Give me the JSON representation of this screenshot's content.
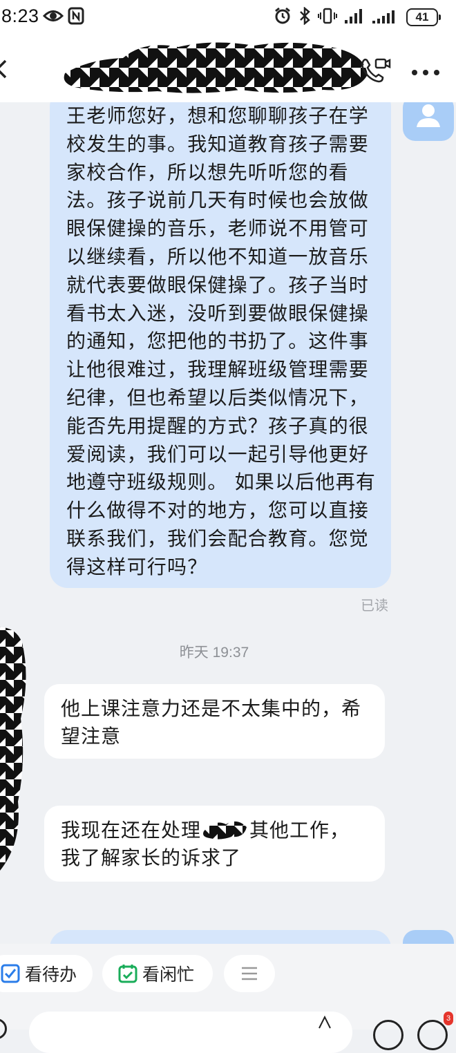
{
  "status_bar": {
    "time": "8:23",
    "battery": "41"
  },
  "header": {
    "contact_name": ""
  },
  "messages": {
    "outgoing": {
      "text": "王老师您好，想和您聊聊孩子在学校发生的事。我知道教育孩子需要家校合作，所以想先听听您的看法。孩子说前几天有时候也会放做眼保健操的音乐，老师说不用管可以继续看，所以他不知道一放音乐就代表要做眼保健操了。孩子当时看书太入迷，没听到要做眼保健操的通知，您把他的书扔了。这件事让他很难过，我理解班级管理需要纪律，但也希望以后类似情况下，能否先用提醒的方式？孩子真的很爱阅读，我们可以一起引导他更好地遵守班级规则。 如果以后他再有什么做得不对的地方，您可以直接联系我们，我们会配合教育。您觉得这样可行吗？",
      "read_status": "已读"
    },
    "timestamp": "昨天 19:37",
    "incoming": [
      {
        "text": "他上课注意力还是不太集中的，希望注意"
      },
      {
        "text_before": "我现在还在处理",
        "text_after": "其他工作，我了解家长的诉求了"
      }
    ]
  },
  "quick_actions": {
    "todo_label": "看待办",
    "free_busy_label": "看闲忙"
  },
  "input": {
    "placeholder": ""
  },
  "colors": {
    "outgoing_bubble": "#d6e6fb",
    "incoming_bubble": "#ffffff",
    "chat_background": "#eff1f4",
    "accent_green": "#1aad5a",
    "accent_blue": "#2b7de9",
    "avatar_blue": "#a9cdf7"
  },
  "icons": {
    "status_left": [
      "eye-icon",
      "nfc-icon"
    ],
    "status_right": [
      "alarm-icon",
      "bluetooth-icon",
      "vibrate-icon",
      "signal-icon",
      "signal-icon",
      "battery-icon"
    ],
    "header": [
      "back-icon",
      "video-call-icon",
      "more-icon"
    ],
    "quick": [
      "checklist-icon",
      "calendar-check-icon",
      "menu-icon"
    ],
    "input": [
      "voice-icon",
      "emoji-icon",
      "plus-icon"
    ]
  }
}
